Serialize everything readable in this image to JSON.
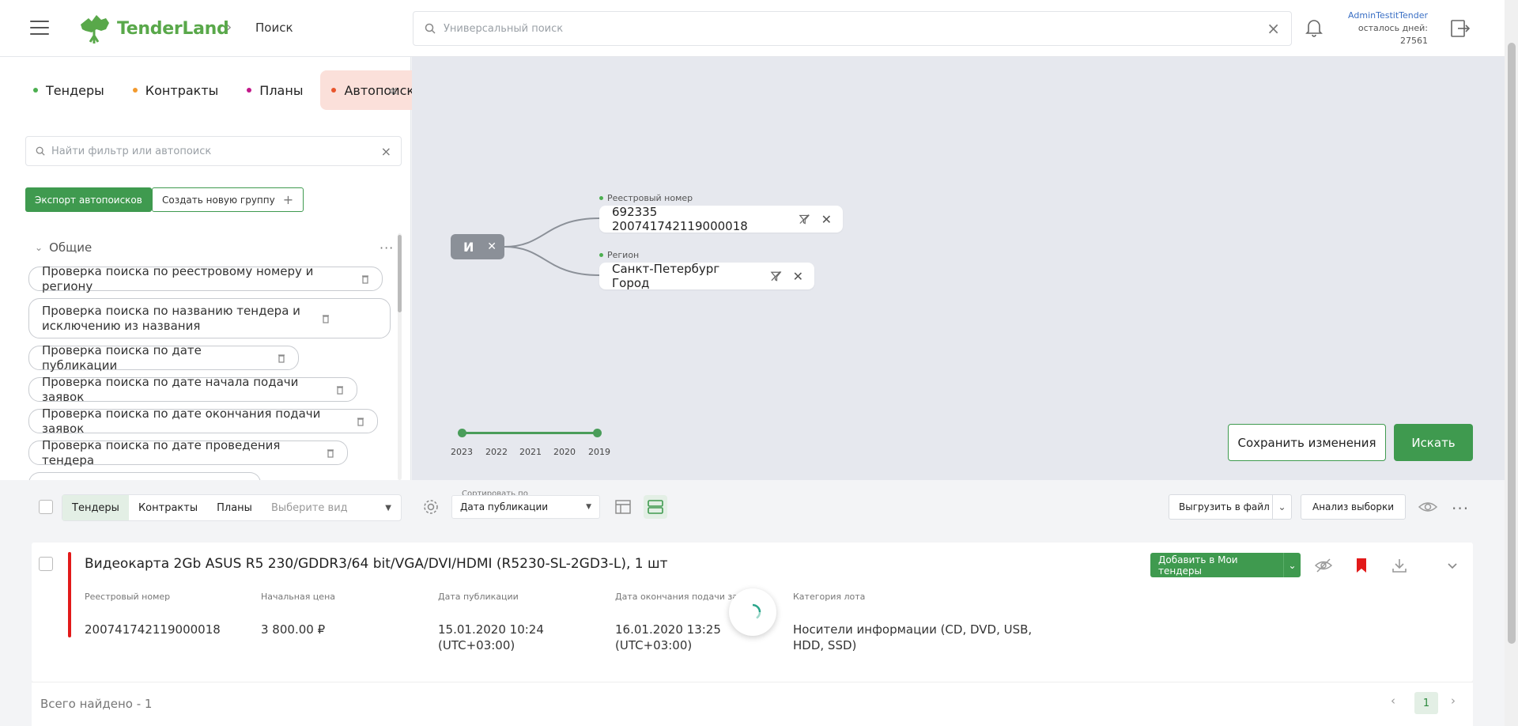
{
  "header": {
    "brand": "TenderLand",
    "breadcrumb": "Поиск",
    "search_placeholder": "Универсальный поиск",
    "user_name": "AdminTestitTender",
    "days_left_label": "осталось дней:",
    "days_left_value": "27561"
  },
  "sidebar": {
    "tabs": [
      {
        "label": "Тендеры",
        "dot": "#4caf50"
      },
      {
        "label": "Контракты",
        "dot": "#f29a2e"
      },
      {
        "label": "Планы",
        "dot": "#c2188a"
      },
      {
        "label": "Автопоиски",
        "dot": "#e8552c"
      }
    ],
    "filter_placeholder": "Найти фильтр или автопоиск",
    "export_label": "Экспорт автопоисков",
    "create_group_label": "Создать новую группу",
    "group_title": "Общие",
    "saved_searches": [
      "Проверка поиска по реестровому номеру и региону",
      "Проверка поиска по названию тендера и исключению из названия",
      "Проверка поиска по дате публикации",
      "Проверка поиска по дате начала подачи заявок",
      "Проверка поиска по дате окончания подачи заявок",
      "Проверка поиска по дате проведения тендера"
    ]
  },
  "canvas": {
    "operator": "И",
    "conditions": [
      {
        "label": "Реестровый номер",
        "value": "692335 200741742119000018"
      },
      {
        "label": "Регион",
        "value": "Санкт-Петербург Город"
      }
    ],
    "timeline_years": [
      "2023",
      "2022",
      "2021",
      "2020",
      "2019"
    ],
    "save_label": "Сохранить изменения",
    "search_label": "Искать"
  },
  "toolbar": {
    "tabs": [
      "Тендеры",
      "Контракты",
      "Планы"
    ],
    "view_placeholder": "Выберите вид",
    "sort_caption": "Сортировать по",
    "sort_value": "Дата публикации",
    "export_label": "Выгрузить в файл",
    "analysis_label": "Анализ выборки"
  },
  "result": {
    "title": "Видеокарта 2Gb ASUS R5 230/GDDR3/64 bit/VGA/DVI/HDMI (R5230-SL-2GD3-L), 1 шт",
    "add_label": "Добавить в Мои тендеры",
    "fields": [
      {
        "label": "Реестровый номер",
        "value": "200741742119000018"
      },
      {
        "label": "Начальная цена",
        "value": "3 800.00 ₽"
      },
      {
        "label": "Дата публикации",
        "value": "15.01.2020 10:24\n(UTC+03:00)"
      },
      {
        "label": "Дата окончания подачи заявок",
        "value": "16.01.2020 13:25\n(UTC+03:00)"
      },
      {
        "label": "Категория лота",
        "value": "Носители информации (CD, DVD, USB,\nHDD, SSD)"
      }
    ],
    "accent_color": "#e21a1a"
  },
  "footer": {
    "total_label": "Всего найдено - 1",
    "current_page": "1"
  },
  "colors": {
    "brand_green": "#3f9a4f",
    "logo_green": "#59a84a",
    "active_tab_bg": "#fbe0da"
  }
}
